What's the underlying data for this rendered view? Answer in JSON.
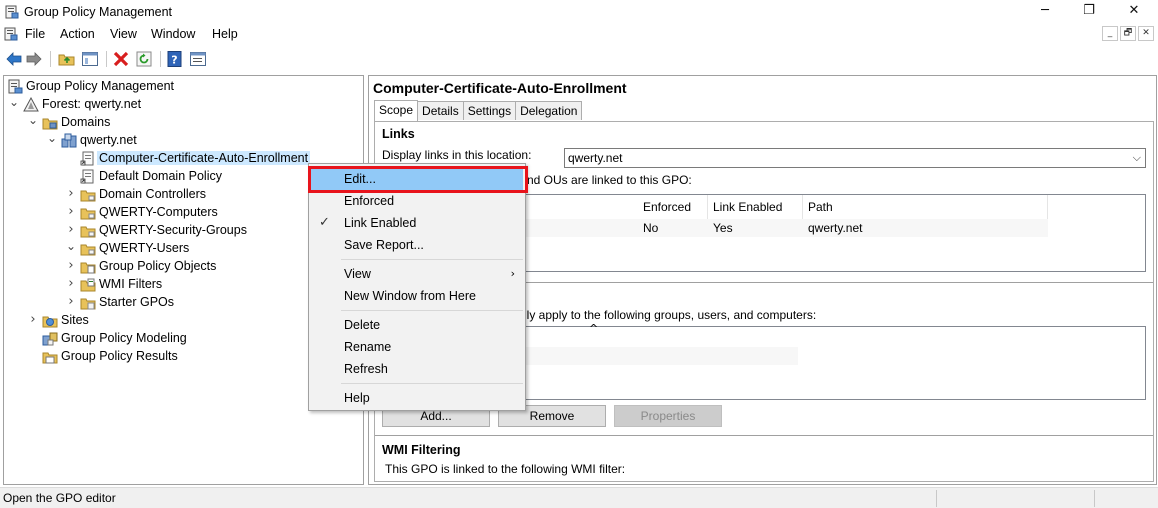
{
  "window": {
    "title": "Group Policy Management",
    "minimize": "─",
    "restore": "❐",
    "close": "✕"
  },
  "menubar": {
    "items": [
      "File",
      "Action",
      "View",
      "Window",
      "Help"
    ],
    "mdi": [
      "_",
      "🗗",
      "✕"
    ]
  },
  "toolbar": {
    "buttons": [
      "back-icon",
      "forward-icon",
      "up-folder-icon",
      "show-hide-tree-icon",
      "delete-icon",
      "refresh-icon",
      "help-icon",
      "properties-icon"
    ]
  },
  "tree": {
    "items": [
      {
        "label": "Group Policy Management",
        "icon": "gpm-icon",
        "level": 0,
        "chevron": ""
      },
      {
        "label": "Forest: qwerty.net",
        "icon": "forest-icon",
        "level": 0,
        "chevron": "expanded"
      },
      {
        "label": "Domains",
        "icon": "domains-folder-icon",
        "level": 1,
        "chevron": "expanded"
      },
      {
        "label": "qwerty.net",
        "icon": "domain-icon",
        "level": 2,
        "chevron": "expanded"
      },
      {
        "label": "Computer-Certificate-Auto-Enrollment",
        "icon": "gpo-link-icon",
        "level": 3,
        "chevron": "",
        "selected": true
      },
      {
        "label": "Default Domain Policy",
        "icon": "gpo-link-icon",
        "level": 3,
        "chevron": ""
      },
      {
        "label": "Domain Controllers",
        "icon": "ou-folder-icon",
        "level": 3,
        "chevron": "collapsed"
      },
      {
        "label": "QWERTY-Computers",
        "icon": "ou-folder-icon",
        "level": 3,
        "chevron": "collapsed"
      },
      {
        "label": "QWERTY-Security-Groups",
        "icon": "ou-folder-icon",
        "level": 3,
        "chevron": "collapsed"
      },
      {
        "label": "QWERTY-Users",
        "icon": "ou-folder-icon",
        "level": 3,
        "chevron": "expanded"
      },
      {
        "label": "Group Policy Objects",
        "icon": "gpo-folder-icon",
        "level": 3,
        "chevron": "collapsed"
      },
      {
        "label": "WMI Filters",
        "icon": "wmi-folder-icon",
        "level": 3,
        "chevron": "collapsed"
      },
      {
        "label": "Starter GPOs",
        "icon": "starter-folder-icon",
        "level": 3,
        "chevron": "collapsed"
      },
      {
        "label": "Sites",
        "icon": "sites-icon",
        "level": 1,
        "chevron": "collapsed"
      },
      {
        "label": "Group Policy Modeling",
        "icon": "modeling-icon",
        "level": 1,
        "chevron": ""
      },
      {
        "label": "Group Policy Results",
        "icon": "results-icon",
        "level": 1,
        "chevron": ""
      }
    ]
  },
  "right": {
    "gpo_title": "Computer-Certificate-Auto-Enrollment",
    "tabs": [
      "Scope",
      "Details",
      "Settings",
      "Delegation"
    ],
    "links": {
      "heading": "Links",
      "display_label": "Display links in this location:",
      "location_value": "qwerty.net",
      "partial_desc": "nd OUs are linked to this GPO:",
      "columns": [
        "Enforced",
        "Link Enabled",
        "Path"
      ],
      "rows": [
        {
          "enforced": "No",
          "link_enabled": "Yes",
          "path": "qwerty.net"
        }
      ]
    },
    "security": {
      "partial_desc": "nly apply to the following groups, users, and computers:",
      "sort_glyph": "^",
      "add_label": "Add...",
      "remove_label": "Remove",
      "properties_label": "Properties"
    },
    "wmi": {
      "heading": "WMI Filtering",
      "desc": "This GPO is linked to the following WMI filter:"
    }
  },
  "context_menu": {
    "items": [
      {
        "label": "Edit...",
        "highlighted": true
      },
      {
        "label": "Enforced"
      },
      {
        "label": "Link Enabled",
        "checked": true
      },
      {
        "label": "Save Report..."
      },
      {
        "label": "View",
        "submenu": true
      },
      {
        "label": "New Window from Here"
      },
      {
        "label": "Delete"
      },
      {
        "label": "Rename"
      },
      {
        "label": "Refresh"
      },
      {
        "label": "Help"
      }
    ],
    "check_glyph": "✓",
    "submenu_glyph": "›"
  },
  "status": {
    "text": "Open the GPO editor"
  },
  "colors": {
    "selection": "#cce8ff",
    "menu_highlight": "#91c9f7",
    "annotation_red": "#e8141c"
  }
}
